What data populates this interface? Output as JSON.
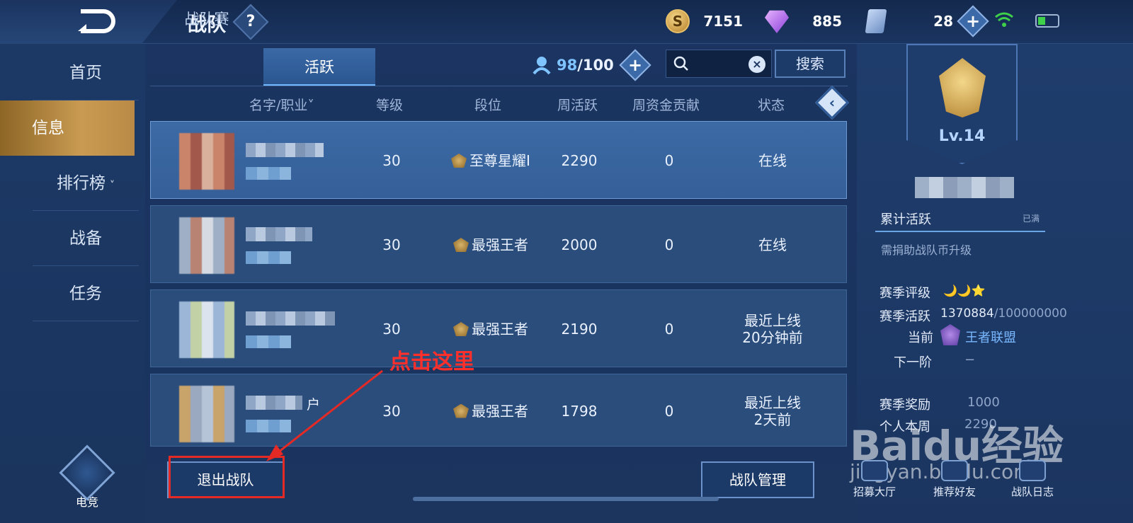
{
  "header": {
    "title": "战队",
    "help_label": "?",
    "gold": "7151",
    "gems": "885",
    "cards": "28",
    "plus_label": "+"
  },
  "nav": {
    "items": [
      {
        "label": "首页"
      },
      {
        "label": "信息"
      },
      {
        "label": "排行榜",
        "arrow": "˅"
      },
      {
        "label": "战备"
      },
      {
        "label": "任务"
      }
    ],
    "esports_label": "电竞"
  },
  "tabs": [
    {
      "label": "战队赛"
    },
    {
      "label": "活跃"
    }
  ],
  "members_count": {
    "current": "98",
    "max": "/100"
  },
  "search": {
    "placeholder": "",
    "clear_label": "×",
    "button_label": "搜索"
  },
  "columns": [
    "名字/职业˅",
    "等级",
    "段位",
    "周活跃",
    "周资金贡献",
    "状态"
  ],
  "collapse_label": "‹",
  "rows": [
    {
      "level": "30",
      "rank": "至尊星耀I",
      "weekly_active": "2290",
      "contribution": "0",
      "status": "在线"
    },
    {
      "level": "30",
      "rank": "最强王者",
      "weekly_active": "2000",
      "contribution": "0",
      "status": "在线"
    },
    {
      "level": "30",
      "rank": "最强王者",
      "weekly_active": "2190",
      "contribution": "0",
      "status": "最近上线\n20分钟前"
    },
    {
      "level": "30",
      "rank": "最强王者",
      "weekly_active": "1798",
      "contribution": "0",
      "status": "最近上线\n2天前",
      "name_suffix": "户"
    }
  ],
  "buttons": {
    "exit": "退出战队",
    "manage": "战队管理"
  },
  "annotation": "点击这里",
  "right_panel": {
    "level": "Lv.14",
    "accum_label": "累计活跃",
    "accum_note": "已满",
    "upgrade_note": "需捐助战队币升级",
    "season_rating_label": "赛季评级",
    "season_rating_icons": "🌙🌙⭐",
    "season_active_label": "赛季活跃",
    "season_active_value": "1370884",
    "season_active_max": "/100000000",
    "current_label": "当前",
    "current_value": "王者联盟",
    "next_label": "下一阶",
    "next_value": "−",
    "season_reward_label": "赛季奖励",
    "season_reward_value": "1000",
    "personal_week_label": "个人本周",
    "personal_week_value": "2290",
    "bottom_buttons": [
      "招募大厅",
      "推荐好友",
      "战队日志"
    ]
  },
  "watermark": {
    "line1": "Baidu经验",
    "line2": "jingyan.baidu.com"
  },
  "colors": {
    "accent": "#79b8ff",
    "gold_tab": "#c99b52",
    "annotation": "#ff2f2b"
  }
}
